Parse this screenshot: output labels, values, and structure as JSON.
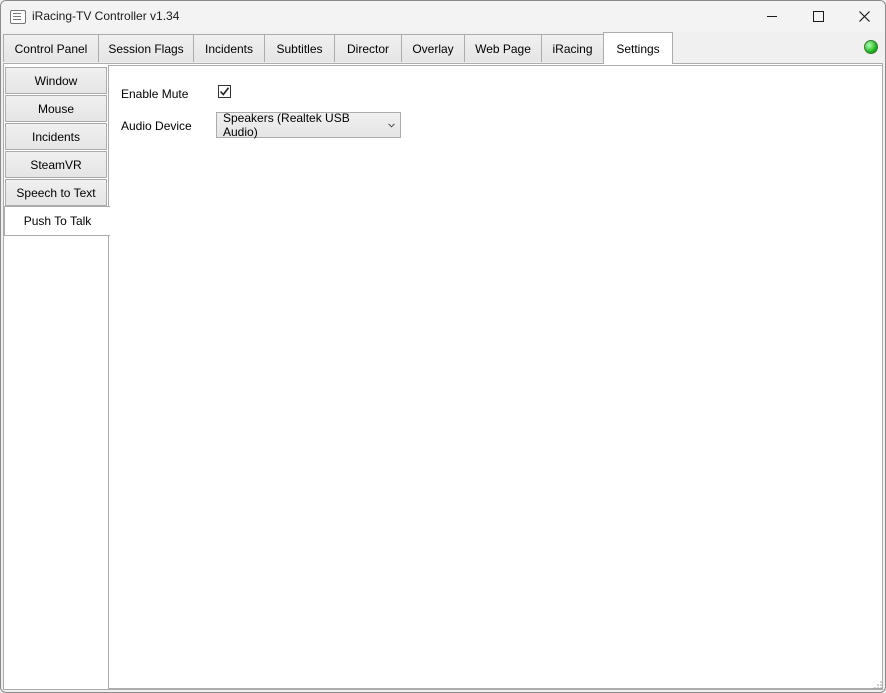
{
  "window": {
    "title": "iRacing-TV Controller v1.34"
  },
  "tabs": [
    {
      "label": "Control Panel"
    },
    {
      "label": "Session Flags"
    },
    {
      "label": "Incidents"
    },
    {
      "label": "Subtitles"
    },
    {
      "label": "Director"
    },
    {
      "label": "Overlay"
    },
    {
      "label": "Web Page"
    },
    {
      "label": "iRacing"
    },
    {
      "label": "Settings",
      "active": true
    }
  ],
  "status_led_color": "#1fb81f",
  "side_tabs": [
    {
      "label": "Window"
    },
    {
      "label": "Mouse"
    },
    {
      "label": "Incidents"
    },
    {
      "label": "SteamVR"
    },
    {
      "label": "Speech to Text"
    },
    {
      "label": "Push To Talk",
      "active": true
    }
  ],
  "push_to_talk": {
    "enable_mute_label": "Enable Mute",
    "enable_mute_checked": true,
    "audio_device_label": "Audio Device",
    "audio_device_value": "Speakers (Realtek USB Audio)"
  }
}
